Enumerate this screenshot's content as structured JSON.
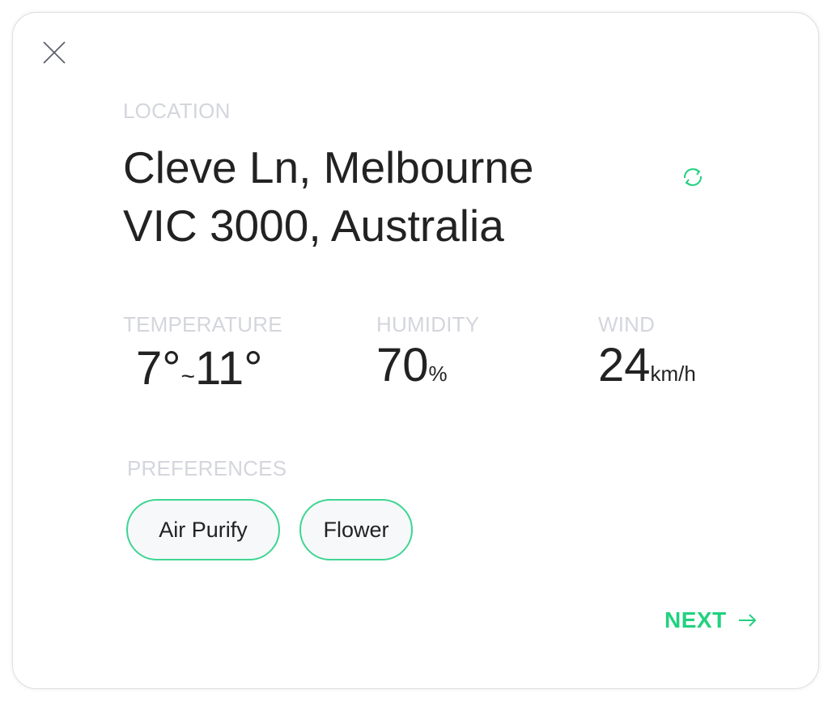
{
  "location": {
    "label": "LOCATION",
    "address_line1": "Cleve Ln, Melbourne",
    "address_line2": "VIC 3000, Australia",
    "refresh_icon": "refresh-icon"
  },
  "stats": {
    "temperature": {
      "label": "TEMPERATURE",
      "min": "7°",
      "separator": "~",
      "max": "11°"
    },
    "humidity": {
      "label": "HUMIDITY",
      "value": "70",
      "unit": "%"
    },
    "wind": {
      "label": "WIND",
      "value": "24",
      "unit": "km/h"
    }
  },
  "preferences": {
    "label": "PREFERENCES",
    "chips": [
      "Air Purify",
      "Flower"
    ]
  },
  "actions": {
    "next_label": "NEXT",
    "close_icon": "close-icon"
  },
  "colors": {
    "accent": "#22d17f",
    "chip_border": "#3fd592",
    "label_gray": "#d4d6dc",
    "text": "#222222"
  }
}
